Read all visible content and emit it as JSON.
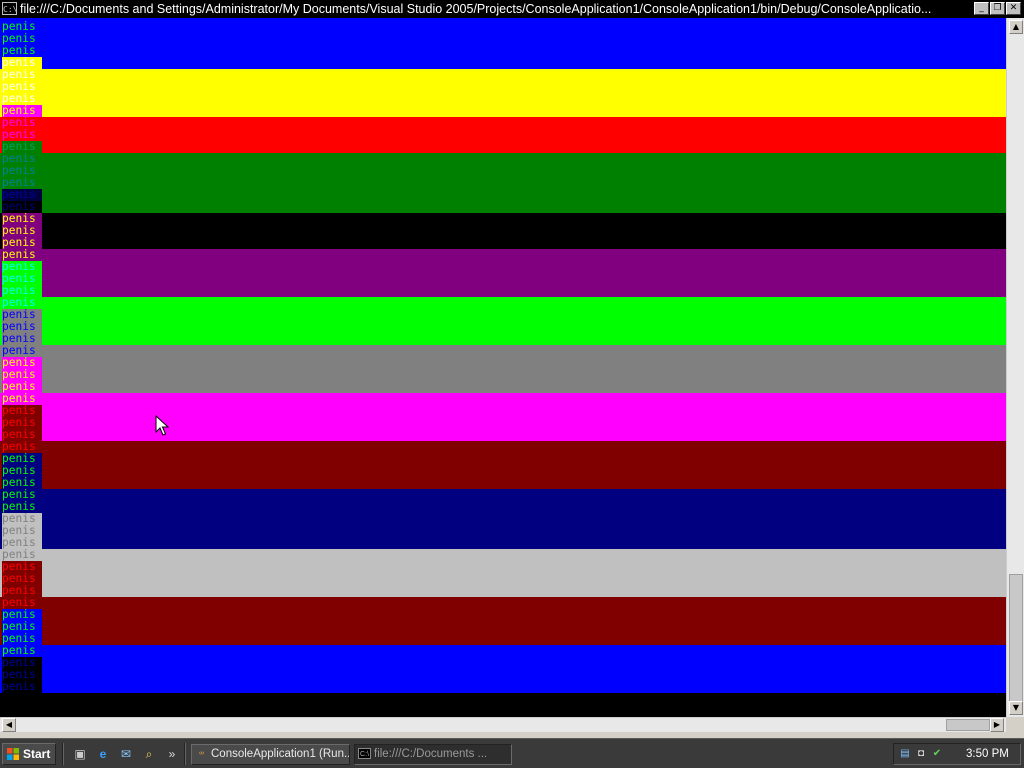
{
  "window": {
    "title": "file:///C:/Documents and Settings/Administrator/My Documents/Visual Studio 2005/Projects/ConsoleApplication1/ConsoleApplication1/bin/Debug/ConsoleApplicatio...",
    "app_icon": "C:\\",
    "controls": {
      "minimize": "_",
      "restore": "❐",
      "close": "✕"
    }
  },
  "console": {
    "word": "penis",
    "colors": {
      "blue": "#0000ff",
      "yellow": "#ffff00",
      "red": "#ff0000",
      "green": "#008000",
      "black": "#000000",
      "purple": "#800080",
      "lime": "#00ff00",
      "gray": "#808080",
      "magenta": "#ff00ff",
      "maroon": "#800000",
      "navy": "#000080",
      "silver": "#c0c0c0"
    },
    "lines": [
      {
        "text": "penis",
        "fg": "#00ff00",
        "bg": "#0000ff"
      },
      {
        "text": "penis",
        "fg": "#00ff00",
        "bg": "#0000ff"
      },
      {
        "text": "penis",
        "fg": "#00ff00",
        "bg": "#0000ff"
      },
      {
        "text": "penis",
        "fg": "#ffffff",
        "bg": "#ffff00"
      },
      {
        "text": "penis",
        "fg": "#ffffff",
        "bg": "#ffff00"
      },
      {
        "text": "penis",
        "fg": "#ffffff",
        "bg": "#ffff00"
      },
      {
        "text": "penis",
        "fg": "#ffffff",
        "bg": "#ffff00"
      },
      {
        "text": "penis",
        "fg": "#ffff00",
        "bg": "#ff00ff"
      },
      {
        "text": "penis",
        "fg": "#ff00ff",
        "bg": "#ff0000"
      },
      {
        "text": "penis",
        "fg": "#ff00ff",
        "bg": "#ff0000"
      },
      {
        "text": "penis",
        "fg": "#00a060",
        "bg": "#008000"
      },
      {
        "text": "penis",
        "fg": "#0080a0",
        "bg": "#008000"
      },
      {
        "text": "penis",
        "fg": "#0080a0",
        "bg": "#008000"
      },
      {
        "text": "penis",
        "fg": "#0080a0",
        "bg": "#008000"
      },
      {
        "text": "penis",
        "fg": "#0000a0",
        "bg": "#000040"
      },
      {
        "text": "penis",
        "fg": "#000080",
        "bg": "#000000"
      },
      {
        "text": "penis",
        "fg": "#ffff00",
        "bg": "#800080"
      },
      {
        "text": "penis",
        "fg": "#ffff00",
        "bg": "#800080"
      },
      {
        "text": "penis",
        "fg": "#ffff00",
        "bg": "#800080"
      },
      {
        "text": "penis",
        "fg": "#ffff00",
        "bg": "#800080"
      },
      {
        "text": "penis",
        "fg": "#00ffff",
        "bg": "#00ff00"
      },
      {
        "text": "penis",
        "fg": "#00ffff",
        "bg": "#00ff00"
      },
      {
        "text": "penis",
        "fg": "#00ffff",
        "bg": "#00ff00"
      },
      {
        "text": "penis",
        "fg": "#00ffff",
        "bg": "#00ff00"
      },
      {
        "text": "penis",
        "fg": "#0000ff",
        "bg": "#808080"
      },
      {
        "text": "penis",
        "fg": "#0000ff",
        "bg": "#808080"
      },
      {
        "text": "penis",
        "fg": "#0000ff",
        "bg": "#808080"
      },
      {
        "text": "penis",
        "fg": "#0000ff",
        "bg": "#808080"
      },
      {
        "text": "penis",
        "fg": "#ffff00",
        "bg": "#ff00ff"
      },
      {
        "text": "penis",
        "fg": "#ffff00",
        "bg": "#ff00ff"
      },
      {
        "text": "penis",
        "fg": "#ffff00",
        "bg": "#ff00ff"
      },
      {
        "text": "penis",
        "fg": "#ffff00",
        "bg": "#ff00ff"
      },
      {
        "text": "penis",
        "fg": "#ff0000",
        "bg": "#800000"
      },
      {
        "text": "penis",
        "fg": "#ff0000",
        "bg": "#800000"
      },
      {
        "text": "penis",
        "fg": "#ff0000",
        "bg": "#800000"
      },
      {
        "text": "penis",
        "fg": "#ff0000",
        "bg": "#800000"
      },
      {
        "text": "penis",
        "fg": "#00ff00",
        "bg": "#000080"
      },
      {
        "text": "penis",
        "fg": "#00ff00",
        "bg": "#000080"
      },
      {
        "text": "penis",
        "fg": "#00ff00",
        "bg": "#000080"
      },
      {
        "text": "penis",
        "fg": "#00ff00",
        "bg": "#000080"
      },
      {
        "text": "penis",
        "fg": "#00ff00",
        "bg": "#000080"
      },
      {
        "text": "penis",
        "fg": "#808080",
        "bg": "#c0c0c0"
      },
      {
        "text": "penis",
        "fg": "#808080",
        "bg": "#c0c0c0"
      },
      {
        "text": "penis",
        "fg": "#808080",
        "bg": "#c0c0c0"
      },
      {
        "text": "penis",
        "fg": "#808080",
        "bg": "#c0c0c0"
      },
      {
        "text": "penis",
        "fg": "#ff0000",
        "bg": "#800000"
      },
      {
        "text": "penis",
        "fg": "#ff0000",
        "bg": "#800000"
      },
      {
        "text": "penis",
        "fg": "#ff0000",
        "bg": "#800000"
      },
      {
        "text": "penis",
        "fg": "#ff0000",
        "bg": "#800000"
      },
      {
        "text": "penis",
        "fg": "#00ff00",
        "bg": "#0000ff"
      },
      {
        "text": "penis",
        "fg": "#00ff00",
        "bg": "#0000ff"
      },
      {
        "text": "penis",
        "fg": "#00ff00",
        "bg": "#0000ff"
      },
      {
        "text": "penis",
        "fg": "#00ff00",
        "bg": "#0000ff"
      },
      {
        "text": "penis",
        "fg": "#0000a0",
        "bg": "#000000"
      },
      {
        "text": "penis",
        "fg": "#0000a0",
        "bg": "#000000"
      },
      {
        "text": "penis",
        "fg": "#0000a0",
        "bg": "#000000"
      }
    ],
    "bands": [
      {
        "color": "#0000ff"
      },
      {
        "color": "#ffff00"
      },
      {
        "color": "#ff0000"
      },
      {
        "color": "#008000"
      },
      {
        "color": "#000000"
      },
      {
        "color": "#800080"
      },
      {
        "color": "#00ff00"
      },
      {
        "color": "#808080"
      },
      {
        "color": "#ff00ff"
      },
      {
        "color": "#800000"
      },
      {
        "color": "#000080"
      },
      {
        "color": "#c0c0c0"
      },
      {
        "color": "#800000"
      },
      {
        "color": "#0000ff"
      },
      {
        "color": "#000000"
      }
    ]
  },
  "scrollbars": {
    "vertical": {
      "up_arrow": "▲",
      "down_arrow": "▼",
      "position": 1.0
    },
    "horizontal": {
      "left_arrow": "◀",
      "right_arrow": "▶",
      "position": 1.0
    }
  },
  "taskbar": {
    "start_label": "Start",
    "quick_launch": [
      {
        "icon": "show-desktop-icon",
        "glyph": "▣"
      },
      {
        "icon": "internet-explorer-icon",
        "glyph": "e"
      },
      {
        "icon": "outlook-express-icon",
        "glyph": "✉"
      },
      {
        "icon": "explorer-icon",
        "glyph": "⌕"
      }
    ],
    "overflow_chevron": "»",
    "tasks": [
      {
        "label": "ConsoleApplication1 (Run...",
        "icon": "visual-studio-icon",
        "active": false
      },
      {
        "label": "file:///C:/Documents ...",
        "icon": "console-icon",
        "active": true
      }
    ],
    "tray": {
      "icons": [
        {
          "icon": "network-icon",
          "glyph": "▤"
        },
        {
          "icon": "volume-icon",
          "glyph": "◘"
        },
        {
          "icon": "security-icon",
          "glyph": "✔"
        }
      ],
      "clock": "3:50 PM"
    }
  }
}
